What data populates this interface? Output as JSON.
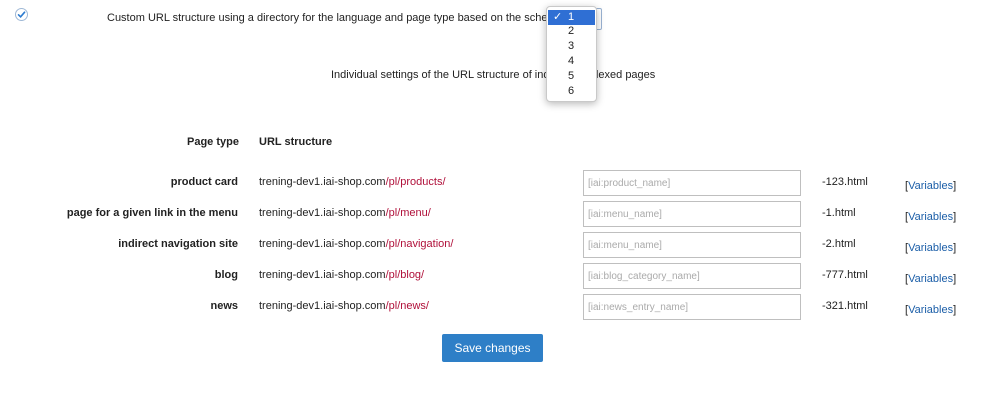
{
  "url_option": {
    "label": "Custom URL structure using a directory for the language and page type based on the scheme",
    "selected_value": "1"
  },
  "scheme_dropdown": {
    "options": [
      "1",
      "2",
      "3",
      "4",
      "5",
      "6"
    ],
    "selected": "1",
    "tick": "✓"
  },
  "subtitle": "Individual settings of the URL structure of individual indexed pages",
  "table": {
    "headers": {
      "page_type": "Page type",
      "url_structure": "URL structure"
    },
    "rows": [
      {
        "label": "product card",
        "domain": "trening-dev1.iai-shop.com",
        "path": "/pl/products/",
        "placeholder": "[iai:product_name]",
        "suffix": "-123.html"
      },
      {
        "label": "page for a given link in the menu",
        "domain": "trening-dev1.iai-shop.com",
        "path": "/pl/menu/",
        "placeholder": "[iai:menu_name]",
        "suffix": "-1.html"
      },
      {
        "label": "indirect navigation site",
        "domain": "trening-dev1.iai-shop.com",
        "path": "/pl/navigation/",
        "placeholder": "[iai:menu_name]",
        "suffix": "-2.html"
      },
      {
        "label": "blog",
        "domain": "trening-dev1.iai-shop.com",
        "path": "/pl/blog/",
        "placeholder": "[iai:blog_category_name]",
        "suffix": "-777.html"
      },
      {
        "label": "news",
        "domain": "trening-dev1.iai-shop.com",
        "path": "/pl/news/",
        "placeholder": "[iai:news_entry_name]",
        "suffix": "-321.html"
      }
    ],
    "variables_link": {
      "open": "[",
      "label": "Variables",
      "close": "]"
    }
  },
  "save_button": "Save changes",
  "colors": {
    "accent": "#2e7fc7",
    "path": "#b0103a",
    "link": "#1b5ea8",
    "dropdown_selected": "#2f6fd4"
  }
}
